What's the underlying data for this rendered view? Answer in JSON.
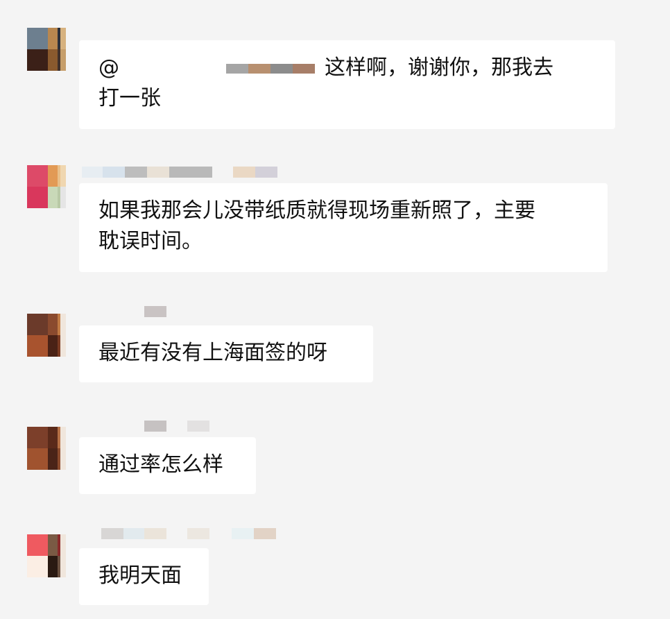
{
  "messages": [
    {
      "mention": "@",
      "text_line1": "这样啊，谢谢你，那我去",
      "text_line2": "打一张"
    },
    {
      "text_line1": "如果我那会儿没带纸质就得现场重新照了，主要",
      "text_line2": "耽误时间。"
    },
    {
      "text": "最近有没有上海面签的呀"
    },
    {
      "text": "通过率怎么样"
    },
    {
      "text": "我明天面"
    }
  ],
  "colors": {
    "background": "#f4f4f4",
    "bubble": "#ffffff",
    "text": "#111111"
  }
}
